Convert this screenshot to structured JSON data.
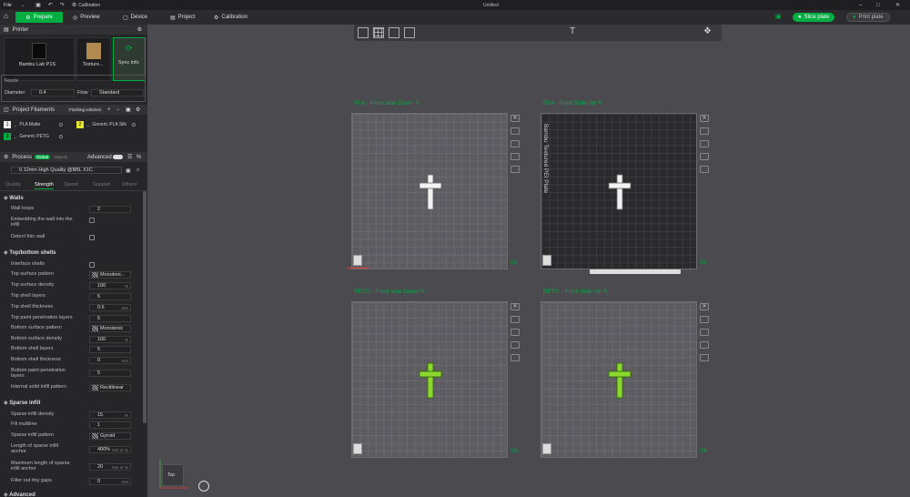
{
  "titlebar": {
    "file_menu": "File",
    "calibration": "Calibration",
    "window_title": "Untitled"
  },
  "toolbar": {
    "prepare": "Prepare",
    "preview": "Preview",
    "device": "Device",
    "project": "Project",
    "calibration": "Calibration",
    "slice_plate": "Slice plate",
    "print_plate": "Print plate"
  },
  "printer": {
    "section": "Printer",
    "printer_name": "Bambu Lab P1S",
    "plate_type": "Texture...",
    "sync": "Sync info",
    "nozzle_label": "Nozzle",
    "diameter_label": "Diameter",
    "diameter_value": "0.4",
    "flow_label": "Flow",
    "flow_value": "Standard"
  },
  "filaments": {
    "section": "Project Filaments",
    "flushing": "Flushing volumes",
    "items": [
      {
        "num": "1",
        "name": "PLA Matte",
        "color": "#111111"
      },
      {
        "num": "2",
        "name": "Generic PLA Silk",
        "color": "#111111"
      },
      {
        "num": "3",
        "name": "Generic PETG",
        "color": "#00ae42"
      }
    ]
  },
  "process": {
    "section": "Process",
    "global": "Global",
    "objects": "Objects",
    "advanced": "Advanced",
    "profile": "0.12mm High Quality @BBL X1C",
    "tabs": [
      "Quality",
      "Strength",
      "Speed",
      "Support",
      "Others"
    ]
  },
  "walls": {
    "title": "Walls",
    "wall_loops_label": "Wall loops",
    "wall_loops": "2",
    "embed_label1": "Embedding the wall into the",
    "embed_label2": "infill",
    "thin_label": "Detect thin wall"
  },
  "topbottom": {
    "title": "Top/bottom shells",
    "interface": "Interface shells",
    "top_pattern_label": "Top surface pattern",
    "top_pattern": "Monotoni...",
    "top_density_label": "Top surface density",
    "top_density": "100",
    "top_layers_label": "Top shell layers",
    "top_layers": "5",
    "top_thick_label": "Top shell thickness",
    "top_thick": "0.6",
    "top_paint_label": "Top paint penetration layers",
    "top_paint": "5",
    "bottom_pattern_label": "Bottom surface pattern",
    "bottom_pattern": "Monotonic",
    "bottom_density_label": "Bottom surface density",
    "bottom_density": "100",
    "bottom_layers_label": "Bottom shell layers",
    "bottom_layers": "5",
    "bottom_thick_label": "Bottom shell thickness",
    "bottom_thick": "0",
    "bottom_paint_label1": "Bottom paint penetration",
    "bottom_paint_label2": "layers",
    "bottom_paint": "5",
    "internal_label": "Internal solid infill pattern",
    "internal": "Rectilinear"
  },
  "infill": {
    "title": "Sparse infill",
    "density_label": "Sparse infill density",
    "density": "15",
    "multiline_label": "Fill multiline",
    "multiline": "1",
    "pattern_label": "Sparse infill pattern",
    "pattern": "Gyroid",
    "anchor_label1": "Length of sparse infill",
    "anchor_label2": "anchor",
    "anchor": "400%",
    "anchor_unit": "mm or %",
    "max_anchor_label1": "Maximum length of sparse",
    "max_anchor_label2": "infill anchor",
    "max_anchor": "20",
    "filter_label": "Filter out tiny gaps",
    "filter": "0",
    "advanced": "Advanced"
  },
  "units": {
    "percent": "%",
    "mm": "mm",
    "mmpct": "mm or %"
  },
  "plates": [
    {
      "label": "PLA - Front side Down",
      "num": "01",
      "plate_text": "",
      "bar": ""
    },
    {
      "label": "PLA - Front Side Up",
      "num": "02",
      "plate_text": "Bambu Textured PEI Plate",
      "bar": ""
    },
    {
      "label": "PETG - Front side Down",
      "num": "03",
      "plate_text": "",
      "bar": ""
    },
    {
      "label": "PETG - Front Side Up",
      "num": "04",
      "plate_text": "",
      "bar": ""
    }
  ],
  "viewcube": {
    "label": "Top"
  },
  "colors": {
    "accent": "#00ae42"
  }
}
